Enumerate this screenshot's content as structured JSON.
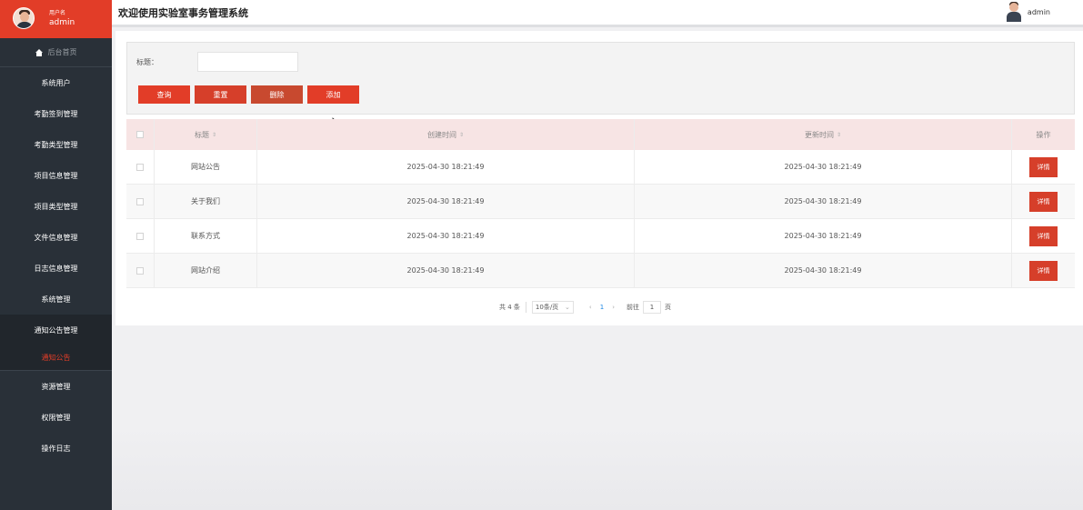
{
  "sidebar": {
    "user_label": "用户名",
    "user_name": "admin",
    "home": "后台首页",
    "items": [
      "系统用户",
      "考勤签到管理",
      "考勤类型管理",
      "项目信息管理",
      "项目类型管理",
      "文件信息管理",
      "日志信息管理",
      "系统管理",
      "通知公告管理"
    ],
    "submenu_active": "通知公告",
    "items_after": [
      "资源管理",
      "权限管理",
      "操作日志"
    ]
  },
  "header": {
    "title": "欢迎使用实验室事务管理系统",
    "user": "admin"
  },
  "search": {
    "label": "标题：",
    "value": "",
    "buttons": {
      "query": "查询",
      "reset": "重置",
      "delete": "删除",
      "add": "添加"
    }
  },
  "table": {
    "columns": [
      "标题",
      "创建时间",
      "更新时间",
      "操作"
    ],
    "rows": [
      {
        "title": "网站公告",
        "created": "2025-04-30 18:21:49",
        "updated": "2025-04-30 18:21:49",
        "action": "详情"
      },
      {
        "title": "关于我们",
        "created": "2025-04-30 18:21:49",
        "updated": "2025-04-30 18:21:49",
        "action": "详情"
      },
      {
        "title": "联系方式",
        "created": "2025-04-30 18:21:49",
        "updated": "2025-04-30 18:21:49",
        "action": "详情"
      },
      {
        "title": "网站介绍",
        "created": "2025-04-30 18:21:49",
        "updated": "2025-04-30 18:21:49",
        "action": "详情"
      }
    ]
  },
  "pager": {
    "total": "共 4 条",
    "page_size": "10条/页",
    "current": "1",
    "goto_label": "前往",
    "goto_value": "1",
    "page_unit": "页"
  },
  "colors": {
    "accent": "#e23d28",
    "sidebar": "#293038",
    "header_row": "#f7e4e4"
  }
}
